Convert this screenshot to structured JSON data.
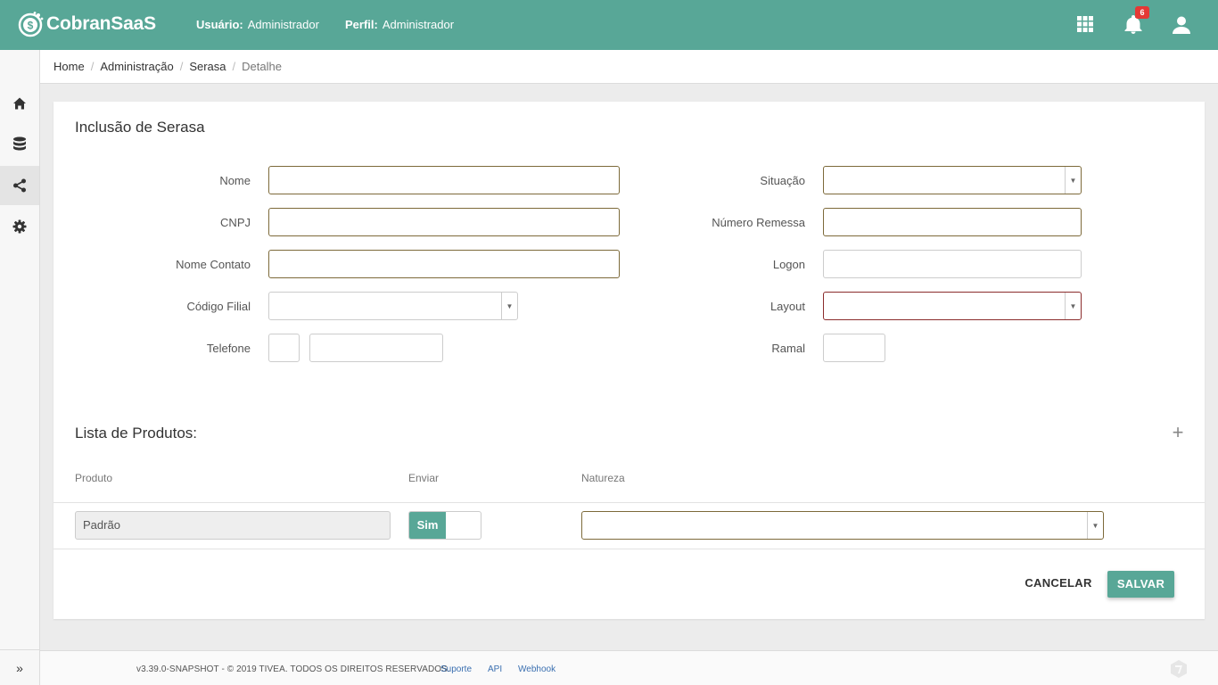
{
  "app": {
    "name": "CobranSaaS",
    "user_label": "Usuário:",
    "user_value": "Administrador",
    "profile_label": "Perfil:",
    "profile_value": "Administrador",
    "notifications_count": "6",
    "brand_color": "#58a797"
  },
  "sidebar": {
    "items": [
      {
        "icon": "home-icon"
      },
      {
        "icon": "database-icon"
      },
      {
        "icon": "share-icon",
        "active": true
      },
      {
        "icon": "gear-icon"
      }
    ],
    "expand_label": "»"
  },
  "breadcrumb": {
    "items": [
      "Home",
      "Administração",
      "Serasa"
    ],
    "current": "Detalhe",
    "separator": "/"
  },
  "form": {
    "title": "Inclusão de Serasa",
    "left": {
      "nome": "Nome",
      "cnpj": "CNPJ",
      "nome_contato": "Nome Contato",
      "codigo_filial": "Código Filial",
      "telefone": "Telefone"
    },
    "right": {
      "situacao": "Situação",
      "numero_remessa": "Número Remessa",
      "logon": "Logon",
      "layout": "Layout",
      "ramal": "Ramal"
    },
    "select_arrow": "▼"
  },
  "produtos": {
    "title": "Lista de Produtos:",
    "add_icon": "+",
    "headers": [
      "Produto",
      "Enviar",
      "Natureza"
    ],
    "rows": [
      {
        "produto": "Padrão",
        "enviar": "Sim",
        "natureza": ""
      }
    ]
  },
  "actions": {
    "cancel": "CANCELAR",
    "save": "SALVAR"
  },
  "footer": {
    "copyright": "v3.39.0-SNAPSHOT - © 2019 TIVEA. TODOS OS DIREITOS RESERVADOS.",
    "links": [
      "Suporte",
      "API",
      "Webhook"
    ]
  }
}
